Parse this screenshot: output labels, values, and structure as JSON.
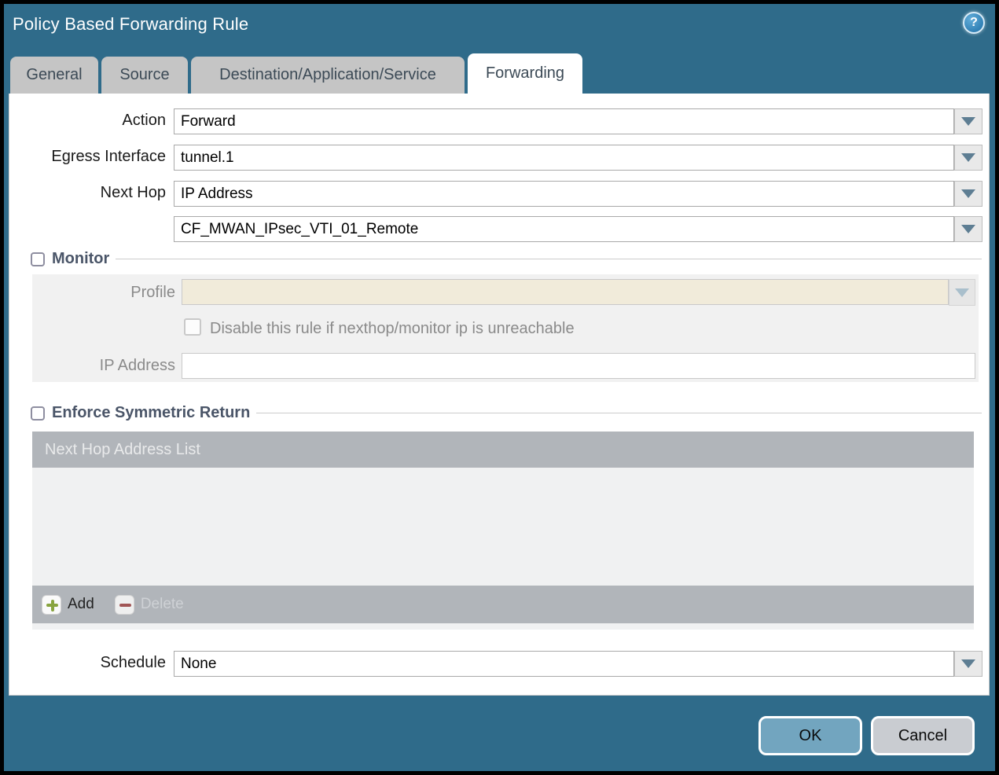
{
  "dialog": {
    "title": "Policy Based Forwarding Rule"
  },
  "tabs": [
    {
      "label": "General",
      "active": false
    },
    {
      "label": "Source",
      "active": false
    },
    {
      "label": "Destination/Application/Service",
      "active": false
    },
    {
      "label": "Forwarding",
      "active": true
    }
  ],
  "form": {
    "action": {
      "label": "Action",
      "value": "Forward"
    },
    "egress_interface": {
      "label": "Egress Interface",
      "value": "tunnel.1"
    },
    "next_hop": {
      "label": "Next Hop",
      "value": "IP Address"
    },
    "next_hop_address": {
      "value": "CF_MWAN_IPsec_VTI_01_Remote"
    },
    "schedule": {
      "label": "Schedule",
      "value": "None"
    }
  },
  "monitor": {
    "legend": "Monitor",
    "checked": false,
    "profile_label": "Profile",
    "profile_value": "",
    "disable_checkbox_label": "Disable this rule if nexthop/monitor ip is unreachable",
    "disable_checked": false,
    "ip_address_label": "IP Address",
    "ip_address_value": ""
  },
  "symmetric_return": {
    "legend": "Enforce Symmetric Return",
    "checked": false,
    "table_header": "Next Hop Address List",
    "rows": [],
    "add_label": "Add",
    "delete_label": "Delete"
  },
  "actions": {
    "ok_label": "OK",
    "cancel_label": "Cancel"
  },
  "icons": {
    "help_glyph": "?",
    "help": "help-icon",
    "dropdown": "chevron-down-icon",
    "add": "plus-icon",
    "delete": "minus-icon"
  },
  "colors": {
    "titlebar_teal": "#2f6b8a",
    "tab_gray": "#c5c5c5",
    "disabled_beige": "#f1ebda",
    "table_gray": "#b1b5ba",
    "ok_blue": "#72a5bf",
    "cancel_gray": "#c9ccd1",
    "add_green": "#88a43f",
    "delete_red": "#a15555"
  }
}
